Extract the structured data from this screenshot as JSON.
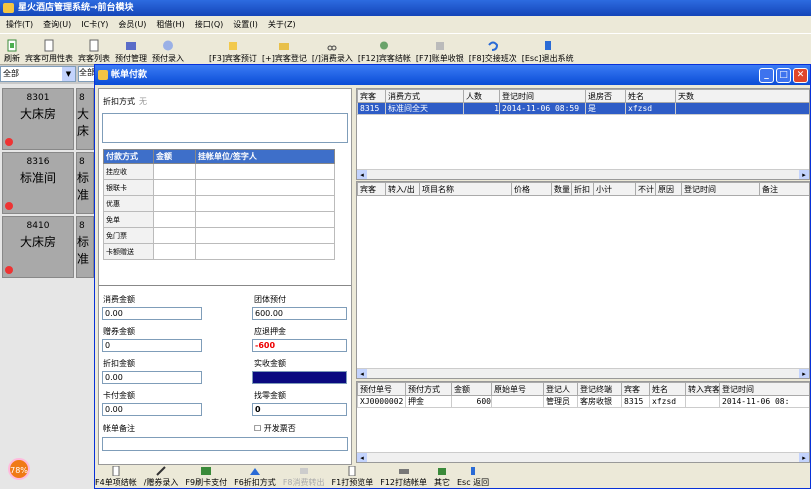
{
  "app": {
    "title": "星火酒店管理系统→前台模块"
  },
  "menu": [
    "操作(T)",
    "查询(U)",
    "IC卡(Y)",
    "会员(U)",
    "租借(H)",
    "接口(Q)",
    "设置(I)",
    "关于(Z)"
  ],
  "toolbar": [
    "刷新",
    "宾客可用性表",
    "宾客列表",
    "预付管理",
    "预付录入",
    "[F3]宾客预订",
    "[+]宾客登记",
    "[/]消费录入",
    "[F12]宾客结帐",
    "[F7]账单收银",
    "[F8]交接班次",
    "[Esc]退出系统"
  ],
  "left": {
    "filter": "全部",
    "filter2": "全部",
    "rooms": [
      {
        "no": "8301",
        "type": "大床房"
      },
      {
        "no": "8316",
        "type": "标准间"
      },
      {
        "no": "8410",
        "type": "大床房"
      }
    ],
    "rooms_right": [
      {
        "no": "8",
        "type": "大床"
      },
      {
        "no": "8",
        "type": "标准"
      },
      {
        "no": "8",
        "type": "标准"
      }
    ],
    "badge": "78%"
  },
  "dialog": {
    "title": "帐单付款",
    "discount_label": "折扣方式",
    "discount_value": "无",
    "pay_headers": [
      "付款方式",
      "金额",
      "挂帐单位/签字人"
    ],
    "pay_rows": [
      "挂应收",
      "银联卡",
      "优惠",
      "免单",
      "免门票",
      "卡额赠送"
    ],
    "fields": {
      "consume_label": "消费金额",
      "consume_value": "0.00",
      "group_prepay_label": "团体预付",
      "group_prepay_value": "600.00",
      "coupon_label": "赠券金额",
      "coupon_value": "0",
      "refund_label": "应退押金",
      "refund_value": "-600",
      "discount_amt_label": "折扣金额",
      "discount_amt_value": "0.00",
      "actual_label": "实收金额",
      "actual_value": "",
      "card_label": "卡付金额",
      "card_value": "0.00",
      "change_label": "找零金额",
      "change_value": "0",
      "note_label": "帐单备注",
      "note_value": "",
      "invoice_label": "开发票否"
    },
    "guest_grid": {
      "headers": [
        "宾客",
        "消费方式",
        "人数",
        "登记时间",
        "退房否",
        "姓名",
        "天数"
      ],
      "rows": [
        [
          "8315",
          "标准间全天",
          "1",
          "2014-11-06 08:59",
          "是",
          "xfzsd",
          ""
        ]
      ]
    },
    "consume_grid": {
      "headers": [
        "宾客",
        "转入/出",
        "项目名称",
        "价格",
        "数量",
        "折扣",
        "小计",
        "不计",
        "原因",
        "登记时间",
        "备注"
      ]
    },
    "prepay_grid": {
      "headers": [
        "预付单号",
        "预付方式",
        "金额",
        "原始单号",
        "登记人",
        "登记终端",
        "宾客",
        "姓名",
        "转入宾客",
        "登记时间"
      ],
      "rows": [
        [
          "XJ0000002",
          "押金",
          "600",
          "",
          "管理员",
          "客房收银",
          "8315",
          "xfzsd",
          "",
          "2014-11-06 08:"
        ]
      ]
    },
    "bottom": [
      "F4单项结帐",
      "/赠券录入",
      "F9刷卡支付",
      "F6折扣方式",
      "F8消费转出",
      "F1打预览单",
      "F12打结帐单",
      "其它",
      "Esc 返回"
    ]
  }
}
